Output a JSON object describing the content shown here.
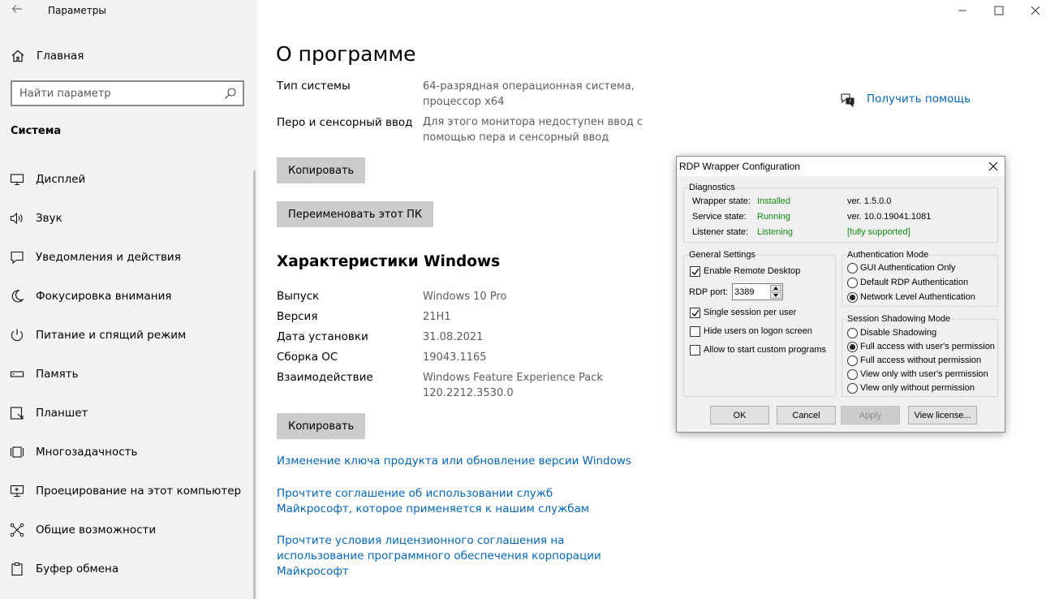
{
  "window": {
    "app_title": "Параметры"
  },
  "sidebar": {
    "home": "Главная",
    "search_placeholder": "Найти параметр",
    "section": "Система",
    "items": [
      {
        "label": "Дисплей",
        "icon": "display-icon"
      },
      {
        "label": "Звук",
        "icon": "speaker-icon"
      },
      {
        "label": "Уведомления и действия",
        "icon": "notification-icon"
      },
      {
        "label": "Фокусировка внимания",
        "icon": "moon-icon"
      },
      {
        "label": "Питание и спящий режим",
        "icon": "power-icon"
      },
      {
        "label": "Память",
        "icon": "storage-icon"
      },
      {
        "label": "Планшет",
        "icon": "tablet-icon"
      },
      {
        "label": "Многозадачность",
        "icon": "multitasking-icon"
      },
      {
        "label": "Проецирование на этот компьютер",
        "icon": "projector-icon"
      },
      {
        "label": "Общие возможности",
        "icon": "shared-icon"
      },
      {
        "label": "Буфер обмена",
        "icon": "clipboard-icon"
      }
    ]
  },
  "main": {
    "title": "О программе",
    "device_specs": [
      {
        "label": "Тип системы",
        "value": "64-разрядная операционная система, процессор x64"
      },
      {
        "label": "Перо и сенсорный ввод",
        "value": "Для этого монитора недоступен ввод с помощью пера и сенсорный ввод"
      }
    ],
    "copy_button": "Копировать",
    "rename_button": "Переименовать этот ПК",
    "windows_specs_title": "Характеристики Windows",
    "windows_specs": [
      {
        "label": "Выпуск",
        "value": "Windows 10 Pro"
      },
      {
        "label": "Версия",
        "value": "21H1"
      },
      {
        "label": "Дата установки",
        "value": "31.08.2021"
      },
      {
        "label": "Сборка ОС",
        "value": "19043.1165"
      },
      {
        "label": "Взаимодействие",
        "value": "Windows Feature Experience Pack 120.2212.3530.0"
      }
    ],
    "copy_button_2": "Копировать",
    "links": [
      "Изменение ключа продукта или обновление версии Windows",
      "Прочтите соглашение об использовании служб Майкрософт, которое применяется к нашим службам",
      "Прочтите условия лицензионного соглашения на использование программного обеспечения корпорации Майкрософт"
    ],
    "help": "Получить помощь"
  },
  "dialog": {
    "title": "RDP Wrapper Configuration",
    "diagnostics": {
      "title": "Diagnostics",
      "wrapper_label": "Wrapper state:",
      "wrapper_value": "Installed",
      "service_label": "Service state:",
      "service_value": "Running",
      "listener_label": "Listener state:",
      "listener_value": "Listening",
      "wrapper_ver": "ver. 1.5.0.0",
      "service_ver": "ver. 10.0.19041.1081",
      "support": "[fully supported]"
    },
    "general": {
      "title": "General Settings",
      "enable_rdp": "Enable Remote Desktop",
      "enable_rdp_checked": true,
      "port_label": "RDP port:",
      "port_value": "3389",
      "single_session": "Single session per user",
      "single_session_checked": true,
      "hide_users": "Hide users on logon screen",
      "hide_users_checked": false,
      "custom_programs": "Allow to start custom programs",
      "custom_programs_checked": false
    },
    "auth": {
      "title": "Authentication Mode",
      "options": [
        "GUI Authentication Only",
        "Default RDP Authentication",
        "Network Level Authentication"
      ],
      "selected": 2
    },
    "shadow": {
      "title": "Session Shadowing Mode",
      "options": [
        "Disable Shadowing",
        "Full access with user's permission",
        "Full access without permission",
        "View only with user's permission",
        "View only without permission"
      ],
      "selected": 1
    },
    "buttons": {
      "ok": "OK",
      "cancel": "Cancel",
      "apply": "Apply",
      "license": "View license..."
    }
  }
}
